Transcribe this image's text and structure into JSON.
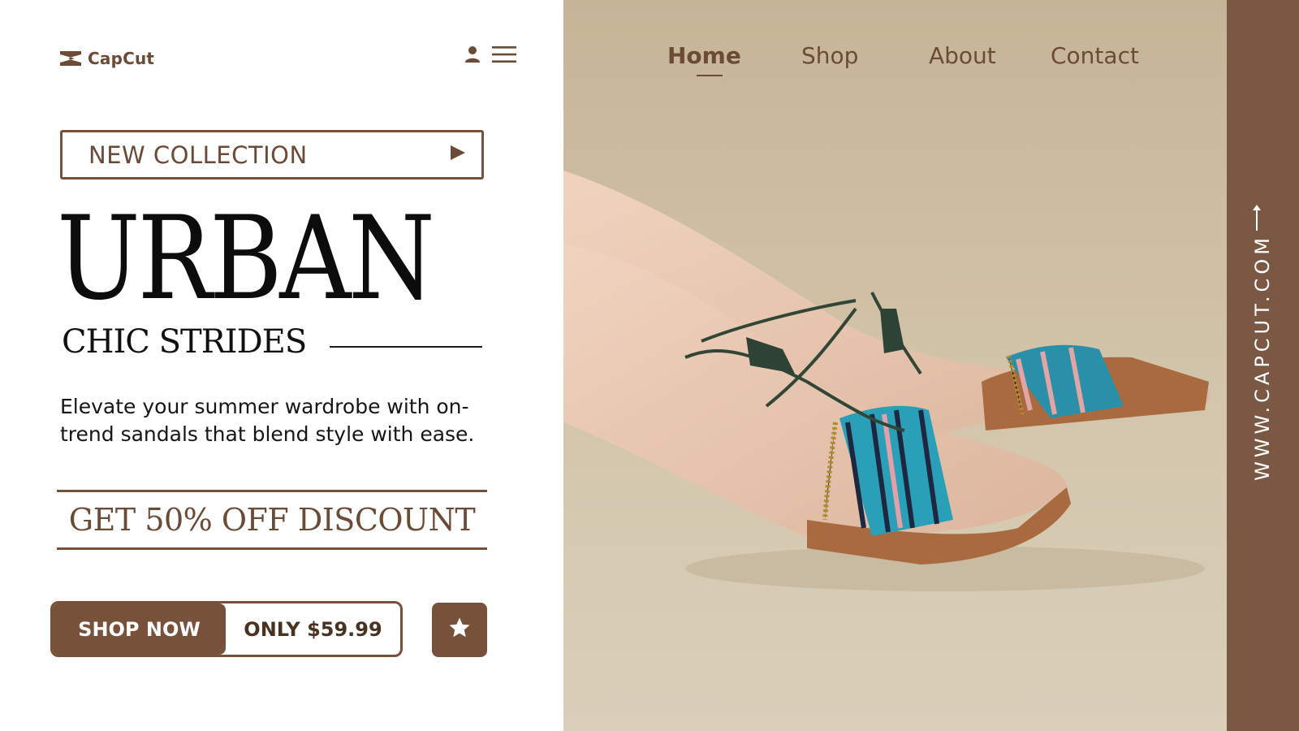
{
  "brand": {
    "name": "CapCut"
  },
  "nav": {
    "items": [
      "Home",
      "Shop",
      "About",
      "Contact"
    ],
    "active": "Home"
  },
  "hero": {
    "tag": "NEW COLLECTION",
    "headline": "URBAN",
    "subheadline": "CHIC STRIDES",
    "description": "Elevate your summer wardrobe with on-trend sandals that blend style with ease.",
    "discount": "GET 50% OFF DISCOUNT"
  },
  "cta": {
    "shop_label": "SHOP NOW",
    "price_label": "ONLY $59.99"
  },
  "sidebar": {
    "url": "WWW.CAPCUT.COM"
  },
  "icons": {
    "logo": "capcut-logo-icon",
    "user": "user-icon",
    "menu": "hamburger-menu-icon",
    "play": "play-triangle-icon",
    "star": "star-icon",
    "arrow": "arrow-up-icon"
  },
  "colors": {
    "accent_brown": "#77513a",
    "text_brown": "#6b4a36",
    "sidebar_brown": "#7b5843",
    "photo_background": "#cfc0a4"
  }
}
